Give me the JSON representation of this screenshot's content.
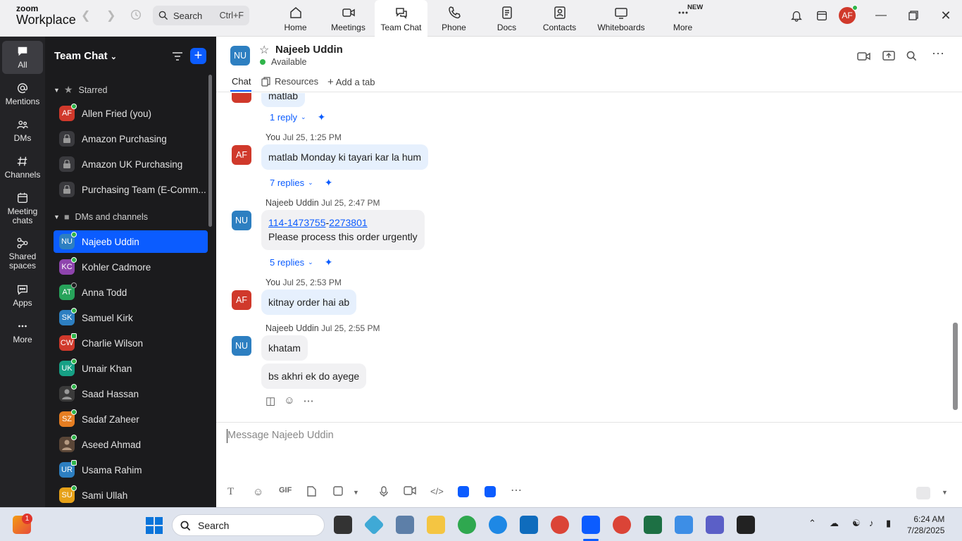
{
  "app": {
    "logo_line1": "zoom",
    "logo_line2": "Workplace"
  },
  "search": {
    "label": "Search",
    "shortcut": "Ctrl+F"
  },
  "nav": [
    {
      "label": "Home"
    },
    {
      "label": "Meetings"
    },
    {
      "label": "Team Chat"
    },
    {
      "label": "Phone"
    },
    {
      "label": "Docs"
    },
    {
      "label": "Contacts"
    },
    {
      "label": "Whiteboards"
    },
    {
      "label": "More"
    }
  ],
  "nav_new_badge": "NEW",
  "user_avatar": "AF",
  "rail": [
    {
      "label": "All"
    },
    {
      "label": "Mentions"
    },
    {
      "label": "DMs"
    },
    {
      "label": "Channels"
    },
    {
      "label": "Meeting chats"
    },
    {
      "label": "Shared spaces"
    },
    {
      "label": "Apps"
    },
    {
      "label": "More"
    }
  ],
  "sidebar": {
    "title": "Team Chat",
    "starred_label": "Starred",
    "starred": [
      {
        "initials": "AF",
        "name": "Allen Fried (you)",
        "color": "#d0392b"
      },
      {
        "name": "Amazon Purchasing"
      },
      {
        "name": "Amazon UK Purchasing"
      },
      {
        "name": "Purchasing Team (E-Comm..."
      }
    ],
    "dms_label": "DMs and channels",
    "dms": [
      {
        "initials": "NU",
        "name": "Najeeb Uddin",
        "color": "#2d7fc1"
      },
      {
        "initials": "KC",
        "name": "Kohler Cadmore",
        "color": "#8e44ad"
      },
      {
        "initials": "AT",
        "name": "Anna Todd",
        "color": "#27a35a"
      },
      {
        "initials": "SK",
        "name": "Samuel Kirk",
        "color": "#2d7fc1"
      },
      {
        "initials": "CW",
        "name": "Charlie Wilson",
        "color": "#d0392b"
      },
      {
        "initials": "UK",
        "name": "Umair Khan",
        "color": "#16a085"
      },
      {
        "initials": "",
        "name": "Saad Hassan",
        "color": "#3b3b3b"
      },
      {
        "initials": "SZ",
        "name": "Sadaf Zaheer",
        "color": "#e67e22"
      },
      {
        "initials": "",
        "name": "Aseed Ahmad",
        "color": "#5a4637"
      },
      {
        "initials": "UR",
        "name": "Usama Rahim",
        "color": "#2d7fc1"
      },
      {
        "initials": "SU",
        "name": "Sami Ullah",
        "color": "#e6a118"
      }
    ]
  },
  "chat": {
    "contact_initials": "NU",
    "contact_name": "Najeeb Uddin",
    "status": "Available",
    "tabs": [
      "Chat",
      "Resources",
      "Add a tab"
    ],
    "partial_msg": "matlab",
    "partial_replies": "1 reply",
    "messages": [
      {
        "sender": "You",
        "time": "Jul 25, 1:25 PM",
        "avatar": "AF",
        "text": "matlab Monday ki tayari kar la hum",
        "replies": "7 replies"
      },
      {
        "sender": "Najeeb Uddin",
        "time": "Jul 25, 2:47 PM",
        "avatar": "NU",
        "link1": "114-1473755",
        "sep": "-",
        "link2": "2273801",
        "text2": "Please process this order urgently",
        "replies": "5 replies"
      },
      {
        "sender": "You",
        "time": "Jul 25, 2:53 PM",
        "avatar": "AF",
        "text": "kitnay order hai ab"
      },
      {
        "sender": "Najeeb Uddin",
        "time": "Jul 25, 2:55 PM",
        "avatar": "NU",
        "text": "khatam",
        "text_b": "bs akhri ek do ayege"
      }
    ]
  },
  "composer": {
    "placeholder": "Message Najeeb Uddin",
    "gif": "GIF"
  },
  "taskbar": {
    "search": "Search",
    "time": "6:24 AM",
    "date": "7/28/2025",
    "badge": "1"
  }
}
